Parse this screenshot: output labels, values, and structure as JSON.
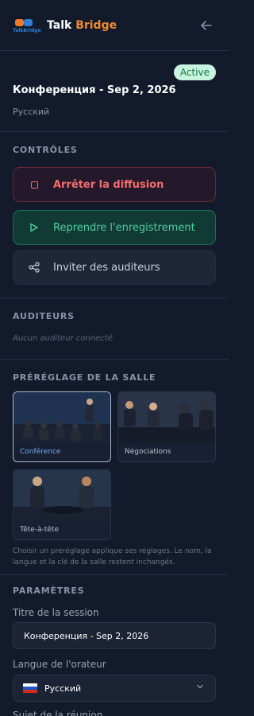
{
  "app": {
    "brand_prefix": "Talk",
    "brand_accent": "Bridge",
    "logo_text": "TalkBridge",
    "back_icon": "arrow-left-icon"
  },
  "session": {
    "status": "Active",
    "title": "Конференция - Sep 2, 2026",
    "language": "Русский"
  },
  "controls": {
    "heading": "CONTRÔLES",
    "stop_label": "Arrêter la diffusion",
    "resume_label": "Reprendre l'enregistrement",
    "invite_label": "Inviter des auditeurs"
  },
  "listeners": {
    "heading": "AUDITEURS",
    "empty_text": "Aucun auditeur connecté"
  },
  "presets": {
    "heading": "PRÉRÉGLAGE DE LA SALLE",
    "items": [
      {
        "label": "Conférence",
        "selected": true
      },
      {
        "label": "Négociations",
        "selected": false
      },
      {
        "label": "Tête-à-tête",
        "selected": false
      }
    ],
    "hint": "Choisir un préréglage applique ses réglages. Le nom, la langue et la clé de la salle restent inchangés."
  },
  "settings": {
    "heading": "PARAMÈTRES",
    "session_title_label": "Titre de la session",
    "session_title_value": "Конференция - Sep 2, 2026",
    "speaker_language_label": "Langue de l'orateur",
    "speaker_language_value": "Русский",
    "next_label": "Sujet de la réunion"
  },
  "colors": {
    "background": "#121a2b",
    "accent": "#f08a2c",
    "stop": "#f26d6d",
    "resume": "#4fd0a0",
    "badge_bg": "#c9f2df",
    "badge_text": "#157a4a"
  }
}
